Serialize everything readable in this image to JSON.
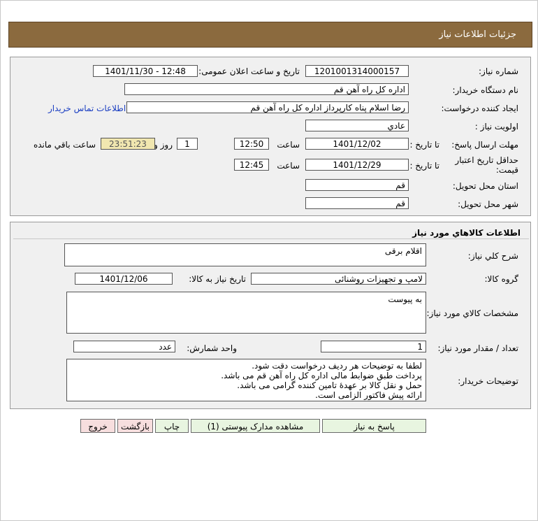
{
  "header": {
    "title": "جزئیات اطلاعات نیاز"
  },
  "details": {
    "need_number_label": "شماره نیاز:",
    "need_number": "1201001314000157",
    "announce_label": "تاریخ و ساعت اعلان عمومی:",
    "announce_value": "1401/11/30 - 12:48",
    "buyer_org_label": "نام دستگاه خریدار:",
    "buyer_org": "اداره کل  راه آهن قم",
    "requester_label": "ایجاد کننده درخواست:",
    "requester": "رضا اسلام پناه کارپرداز اداره کل  راه آهن قم",
    "contact_link": "اطلاعات تماس خریدار",
    "priority_label": "اولویت نیاز :",
    "priority": "عادي",
    "deadline_label": "مهلت ارسال پاسخ:",
    "to_date_label": "تا تاریخ :",
    "deadline_date": "1401/12/02",
    "time_label": "ساعت",
    "deadline_time": "12:50",
    "days_value": "1",
    "days_label": "روز و",
    "remaining_time": "23:51:23",
    "remaining_label": "ساعت باقي مانده",
    "validity_label": "حداقل تاریخ اعتبار قیمت:",
    "validity_to_label": "تا تاریخ :",
    "validity_date": "1401/12/29",
    "validity_time_label": "ساعت",
    "validity_time": "12:45",
    "province_label": "استان محل تحویل:",
    "province": "قم",
    "city_label": "شهر محل تحویل:",
    "city": "قم"
  },
  "goods": {
    "title": "اطلاعات کالاهاي مورد نياز",
    "general_desc_label": "شرح کلي نياز:",
    "general_desc": "اقلام برقی",
    "group_label": "گروه کالا:",
    "group": "لامپ و تجهیزات روشنائی",
    "need_date_label": "تاریخ نیاز به کالا:",
    "need_date": "1401/12/06",
    "specs_label": "مشخصات کالاي مورد نياز:",
    "specs": "به پیوست",
    "qty_label": "تعداد / مقدار مورد نیاز:",
    "qty": "1",
    "unit_label": "واحد شمارش:",
    "unit": "عدد",
    "buyer_notes_label": "توضیحات خریدار:",
    "buyer_notes": [
      "لطفا به توضیحات هر ردیف درخواست دقت شود.",
      "پرداخت طبق ضوابط مالی اداره کل راه آهن قم می باشد.",
      "حمل و نقل کالا بر عهدۀ تامین کننده گرامی می باشد.",
      "ارائه پیش فاکتور الزامی است."
    ]
  },
  "buttons": {
    "respond": "پاسخ به نیاز",
    "view_docs": "مشاهده مدارک پیوستی (1)",
    "print": "چاپ",
    "back": "بازگشت",
    "exit": "خروج"
  }
}
